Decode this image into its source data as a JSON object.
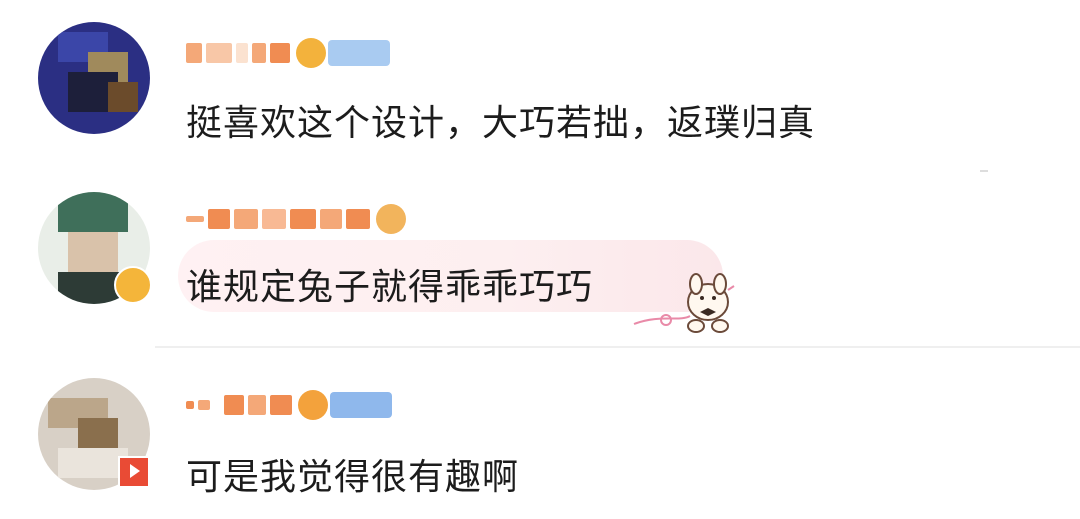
{
  "comments": [
    {
      "text": "挺喜欢这个设计，大巧若拙，返璞归真"
    },
    {
      "text": "谁规定兔子就得乖乖巧巧"
    },
    {
      "text": "可是我觉得很有趣啊"
    }
  ],
  "colors": {
    "username": "#f29a5c",
    "badge": "#9fc4ef",
    "crown": "#f3b23c",
    "divider": "#efefef",
    "bubble": "#fdeff0"
  }
}
